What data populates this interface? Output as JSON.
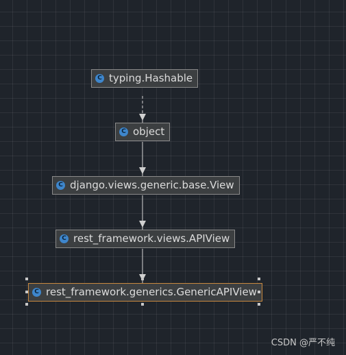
{
  "nodes": [
    {
      "id": "typing_hashable",
      "icon": "class-icon",
      "label": "typing.Hashable"
    },
    {
      "id": "object",
      "icon": "class-icon",
      "label": "object"
    },
    {
      "id": "django_view",
      "icon": "class-icon",
      "label": "django.views.generic.base.View"
    },
    {
      "id": "apiview",
      "icon": "class-icon",
      "label": "rest_framework.views.APIView"
    },
    {
      "id": "genericapiview",
      "icon": "class-icon",
      "label": "rest_framework.generics.GenericAPIView",
      "selected": true
    }
  ],
  "edges": [
    {
      "from": "object",
      "to": "typing_hashable",
      "style": "dashed"
    },
    {
      "from": "django_view",
      "to": "object",
      "style": "solid"
    },
    {
      "from": "apiview",
      "to": "django_view",
      "style": "solid"
    },
    {
      "from": "genericapiview",
      "to": "apiview",
      "style": "solid"
    }
  ],
  "colors": {
    "background": "#1f242b",
    "node_fill": "#3c3f41",
    "node_border": "#8b8b8b",
    "selected_border": "#c9893f",
    "icon": "#3e86cc",
    "edge": "#b4b4b4"
  },
  "watermark": "CSDN @严不纯"
}
